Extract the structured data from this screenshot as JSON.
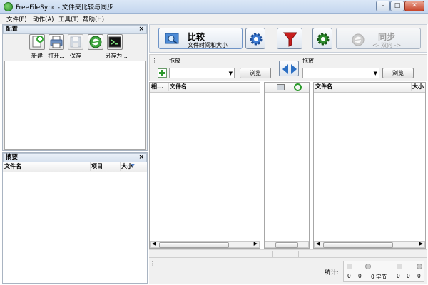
{
  "window": {
    "title": "FreeFileSync - 文件夹比较与同步"
  },
  "menu": {
    "items": [
      "文件(F)",
      "动作(A)",
      "工具(T)",
      "帮助(H)"
    ]
  },
  "config_panel": {
    "title": "配置",
    "close": "×",
    "buttons": [
      {
        "label": "新建",
        "icon": "new-file-icon"
      },
      {
        "label": "打开...",
        "icon": "open-printer-icon"
      },
      {
        "label": "保存",
        "icon": "save-disk-icon"
      },
      {
        "label": "",
        "icon": "green-sync-icon"
      },
      {
        "label": "另存为...",
        "icon": "terminal-icon"
      }
    ]
  },
  "overview_panel": {
    "title": "摘要",
    "close": "×",
    "columns": [
      "文件名",
      "项目",
      "大小"
    ]
  },
  "toolbar": {
    "compare": {
      "title": "比较",
      "subtitle": "文件时间和大小"
    },
    "sync": {
      "title": "同步",
      "subtitle": "<- 双向 ->"
    }
  },
  "folders": {
    "left": {
      "drag_label": "拖放",
      "browse": "浏览"
    },
    "right": {
      "drag_label": "拖放",
      "browse": "浏览"
    }
  },
  "grid": {
    "left_columns": [
      "相...",
      "文件名"
    ],
    "right_columns": [
      "文件名",
      "大小"
    ]
  },
  "status": {
    "stats_label": "统计:",
    "values": [
      "0",
      "0",
      "0 字节",
      "0",
      "0",
      "0"
    ]
  },
  "colors": {
    "titlebar": "#c4d6ee",
    "accent_blue": "#2b6fc4",
    "filter_red": "#c81e1e",
    "gear_green": "#2c8c2c"
  }
}
